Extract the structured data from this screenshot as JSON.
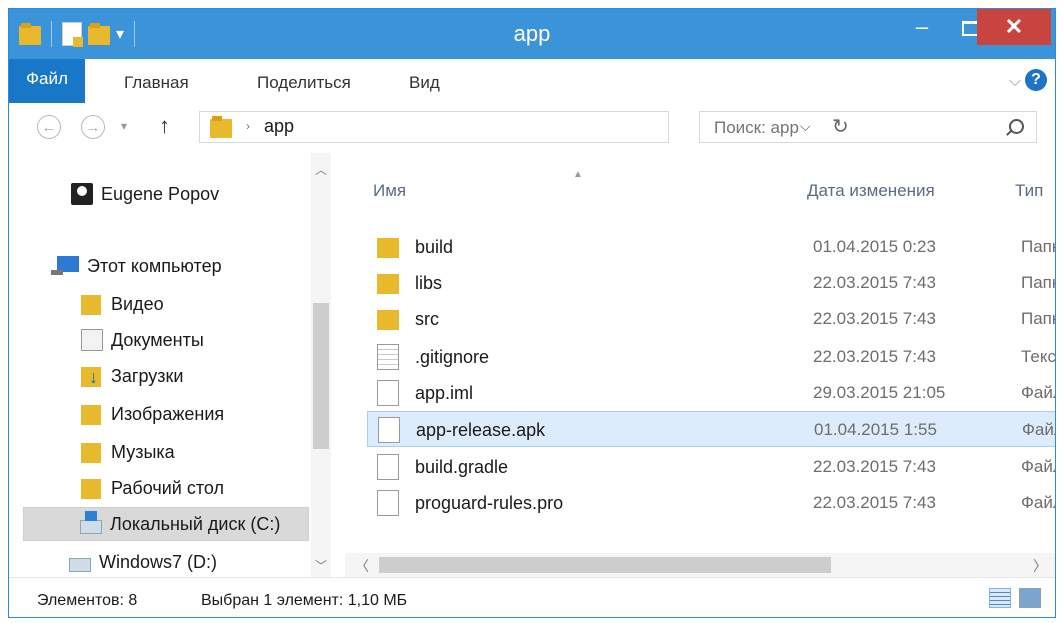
{
  "window": {
    "title": "app"
  },
  "title_buttons": {
    "minimize": "–",
    "close": "✕"
  },
  "ribbon": {
    "file": "Файл",
    "home": "Главная",
    "share": "Поделиться",
    "view": "Вид",
    "expand": "⌵",
    "help": "?"
  },
  "address": {
    "crumb": "app",
    "separator": "›",
    "up": "↑",
    "dropdown": "⌵",
    "refresh": "↻"
  },
  "search": {
    "placeholder": "Поиск: app"
  },
  "nav": {
    "user": "Eugene Popov",
    "computer": "Этот компьютер",
    "items": [
      "Видео",
      "Документы",
      "Загрузки",
      "Изображения",
      "Музыка",
      "Рабочий стол"
    ],
    "drive_c": "Локальный диск (C:)",
    "drive_d": "Windows7 (D:)"
  },
  "columns": {
    "name": "Имя",
    "date": "Дата изменения",
    "type": "Тип"
  },
  "files": [
    {
      "name": "build",
      "date": "01.04.2015 0:23",
      "type": "Папк",
      "icon": "folder-icon"
    },
    {
      "name": "libs",
      "date": "22.03.2015 7:43",
      "type": "Папк",
      "icon": "folder-icon"
    },
    {
      "name": "src",
      "date": "22.03.2015 7:43",
      "type": "Папк",
      "icon": "folder-icon"
    },
    {
      "name": ".gitignore",
      "date": "22.03.2015 7:43",
      "type": "Текст",
      "icon": "text-file-icon"
    },
    {
      "name": "app.iml",
      "date": "29.03.2015 21:05",
      "type": "Файл",
      "icon": "file-icon"
    },
    {
      "name": "app-release.apk",
      "date": "01.04.2015 1:55",
      "type": "Файл",
      "icon": "file-icon"
    },
    {
      "name": "build.gradle",
      "date": "22.03.2015 7:43",
      "type": "Файл",
      "icon": "file-icon"
    },
    {
      "name": "proguard-rules.pro",
      "date": "22.03.2015 7:43",
      "type": "Файл",
      "icon": "file-icon"
    }
  ],
  "selected_file": "app-release.apk",
  "status": {
    "count": "Элементов: 8",
    "selection": "Выбран 1 элемент: 1,10 МБ"
  },
  "colors": {
    "titlebar": "#3b93d9",
    "file_tab": "#1977c7",
    "close": "#c7443f",
    "selection": "#dcecfc"
  }
}
